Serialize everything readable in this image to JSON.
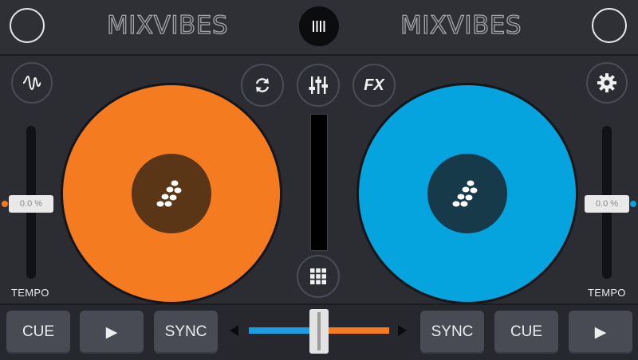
{
  "brand": {
    "left_logo": "MIXVIBES",
    "right_logo": "MIXVIBES"
  },
  "colors": {
    "deck_a": "#f47b20",
    "deck_a_label": "#5a3516",
    "deck_b": "#06a4df",
    "deck_b_label": "#163a4a",
    "crossfader_left": "#1a9ee0",
    "crossfader_right": "#f47b20"
  },
  "toolbar": {
    "waveform_icon": "waveform-icon",
    "sync_loop_icon": "rotate-arrows-icon",
    "mixer_icon": "mixer-sliders-icon",
    "fx_label": "FX",
    "settings_icon": "gear-icon",
    "menu_icon": "bars-icon",
    "sampler_icon": "grid-icon"
  },
  "deck_a": {
    "tempo_value": "0.0 %",
    "tempo_label": "TEMPO",
    "cue_label": "CUE",
    "play_label": "▶",
    "sync_label": "SYNC"
  },
  "deck_b": {
    "tempo_value": "0.0 %",
    "tempo_label": "TEMPO",
    "cue_label": "CUE",
    "play_label": "▶",
    "sync_label": "SYNC"
  },
  "crossfader": {
    "position": 0.5
  }
}
